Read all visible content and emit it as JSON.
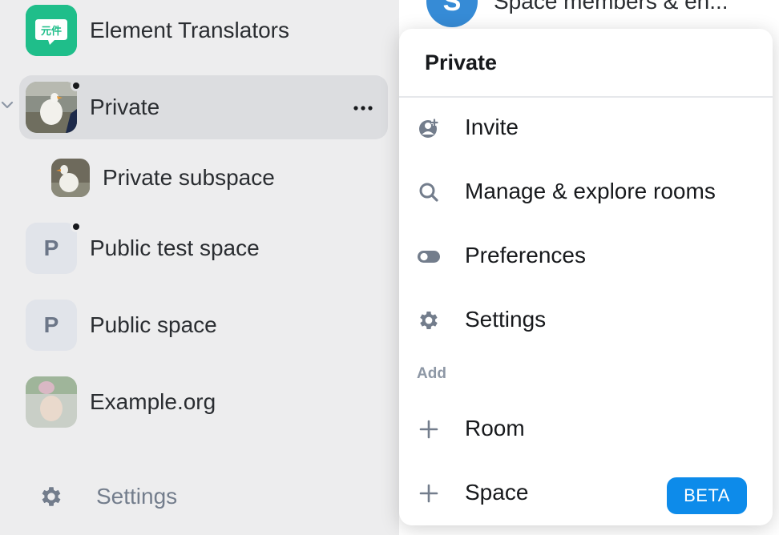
{
  "sidebar": {
    "spaces": [
      {
        "label": "Element Translators",
        "avatar_text": "元件",
        "avatar_color": "#1fbe8a"
      },
      {
        "label": "Private",
        "selected": true,
        "unread": true
      },
      {
        "label": "Public test space",
        "avatar_letter": "P",
        "unread": true
      },
      {
        "label": "Public space",
        "avatar_letter": "P"
      },
      {
        "label": "Example.org"
      }
    ],
    "subspace": {
      "label": "Private subspace"
    },
    "more_icon": "ellipsis-icon",
    "settings_label": "Settings"
  },
  "room_list": {
    "avatar_letter": "S",
    "room_name": "Space members & en..."
  },
  "context_menu": {
    "title": "Private",
    "items": [
      {
        "label": "Invite",
        "icon": "invite-icon"
      },
      {
        "label": "Manage & explore rooms",
        "icon": "search-icon"
      },
      {
        "label": "Preferences",
        "icon": "toggle-icon"
      },
      {
        "label": "Settings",
        "icon": "gear-icon"
      }
    ],
    "section_label": "Add",
    "add_items": [
      {
        "label": "Room",
        "icon": "plus-icon"
      },
      {
        "label": "Space",
        "icon": "plus-icon",
        "badge": "BETA"
      }
    ]
  },
  "colors": {
    "accent": "#0d8bea",
    "selected_bg": "#dcdde0",
    "sidebar_bg": "#ededee"
  }
}
